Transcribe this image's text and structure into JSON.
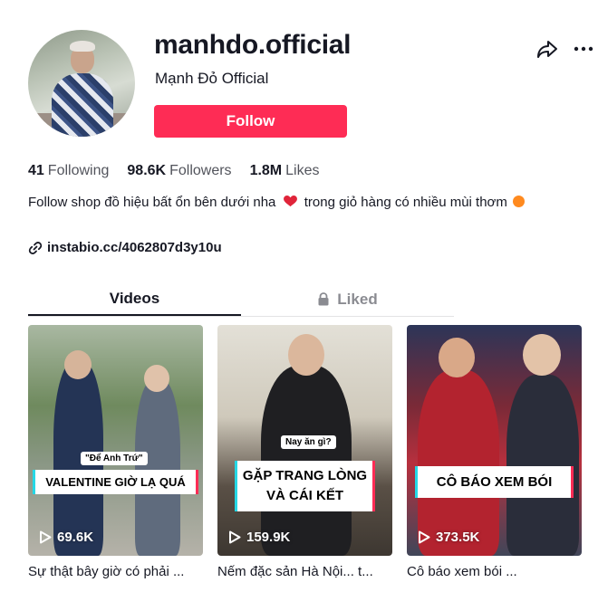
{
  "profile": {
    "username": "manhdo.official",
    "nickname": "Mạnh Đỏ Official",
    "follow_label": "Follow",
    "avatar_icon": "profile-photo"
  },
  "header_actions": {
    "share_icon": "share-icon",
    "more_icon": "more-icon"
  },
  "stats": {
    "following_count": "41",
    "following_label": "Following",
    "followers_count": "98.6K",
    "followers_label": "Followers",
    "likes_count": "1.8M",
    "likes_label": "Likes"
  },
  "bio": {
    "part1": "Follow shop đồ hiệu bất ổn bên dưới nha",
    "part2": "trong giỏ hàng có nhiều mùi thơm",
    "heart_color": "#fe2c55",
    "orange_color": "#ff8a1f"
  },
  "link": {
    "url": "instabio.cc/4062807d3y10u"
  },
  "tabs": [
    {
      "label": "Videos",
      "active": true
    },
    {
      "label": "Liked",
      "active": false,
      "icon": "lock-icon"
    }
  ],
  "videos": [
    {
      "overlay_small": "\"Để Anh Trứ\"",
      "overlay_title": "VALENTINE GIỜ LẠ QUÁ",
      "views": "69.6K",
      "description": "Sự thật bây giờ có phải ..."
    },
    {
      "overlay_small": "Nay ăn gì?",
      "overlay_title_line1": "GẶP TRANG LÒNG",
      "overlay_title_line2": "VÀ CÁI KẾT",
      "views": "159.9K",
      "description": "Nếm đặc sản Hà Nội... t..."
    },
    {
      "overlay_title": "CÔ BÁO XEM BÓI",
      "views": "373.5K",
      "description": "Cô báo xem bói ..."
    }
  ],
  "colors": {
    "accent": "#fe2c55",
    "caption_cyan": "#25d8e6",
    "text": "#161823"
  }
}
